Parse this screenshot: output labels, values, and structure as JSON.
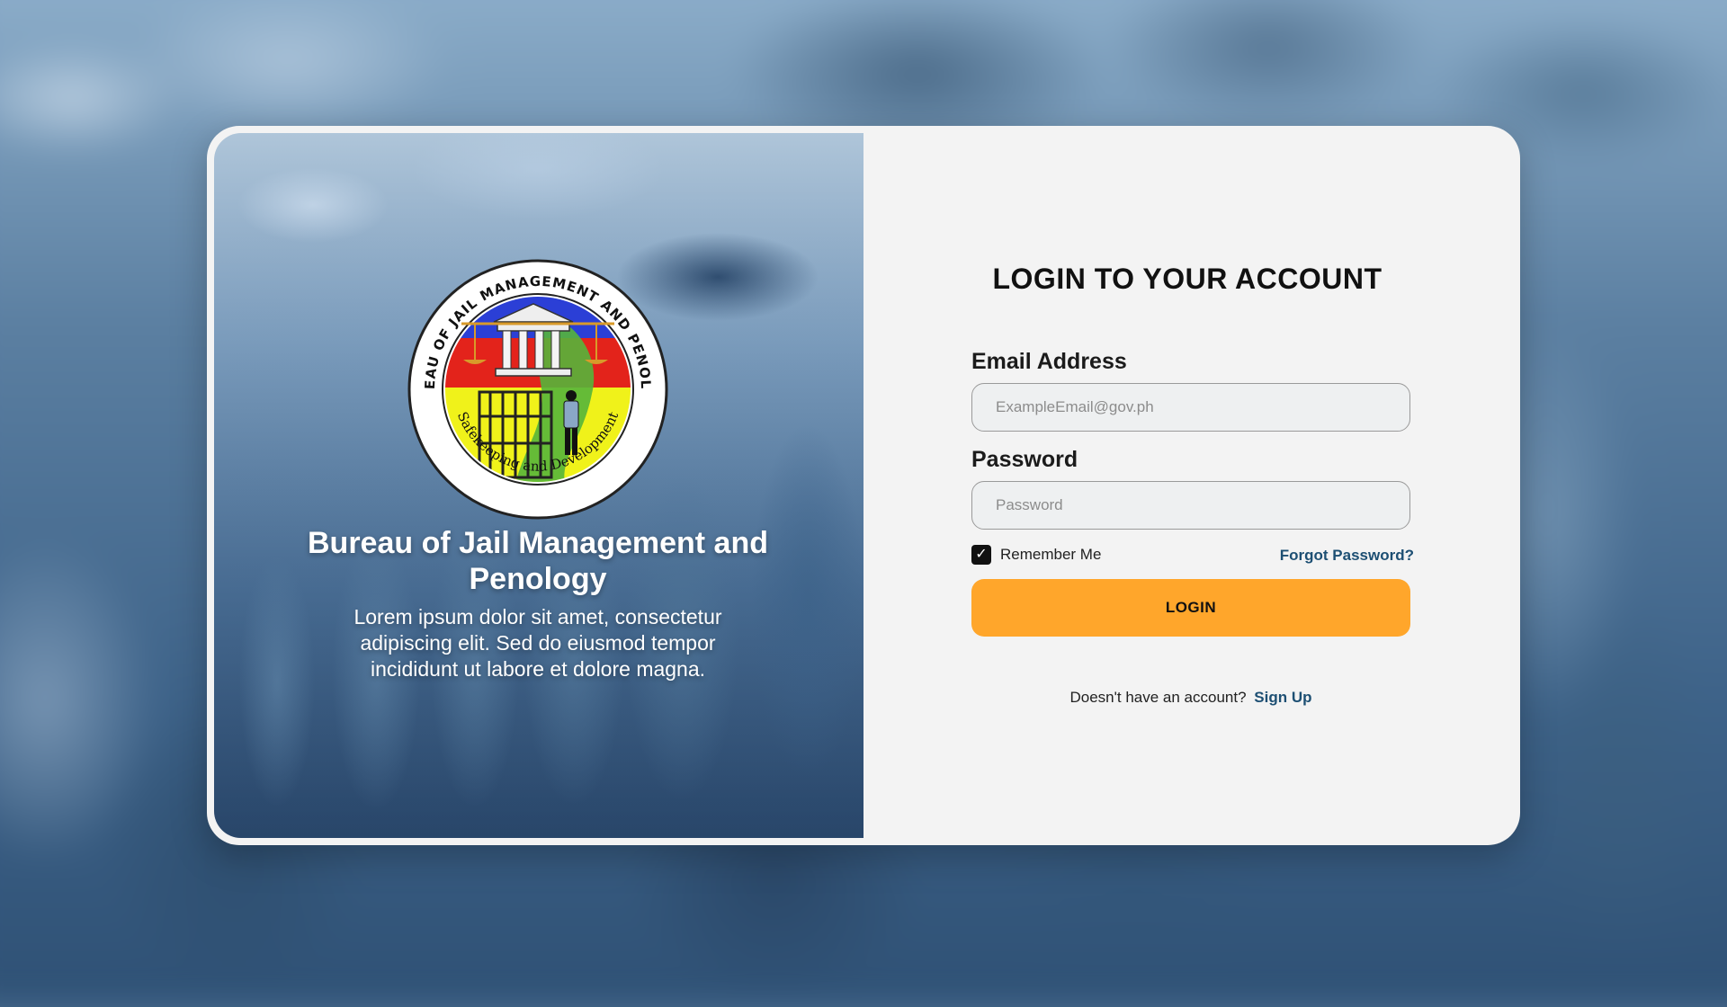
{
  "hero": {
    "org_name": "Bureau of Jail Management and Penology",
    "description": "Lorem ipsum dolor sit amet, consectetur adipiscing elit. Sed do eiusmod tempor incididunt ut labore et dolore magna.",
    "seal": {
      "ring_text_top": "BUREAU OF JAIL MANAGEMENT AND PENOLOGY",
      "ring_text_bottom": "Safekeeping and Development"
    }
  },
  "form": {
    "title": "LOGIN TO YOUR ACCOUNT",
    "email_label": "Email Address",
    "email_placeholder": "ExampleEmail@gov.ph",
    "email_value": "",
    "password_label": "Password",
    "password_placeholder": "Password",
    "password_value": "",
    "remember_label": "Remember Me",
    "remember_checked": true,
    "forgot_label": "Forgot Password?",
    "login_label": "LOGIN",
    "signup_prompt": "Doesn't have an account?",
    "signup_label": "Sign Up"
  },
  "colors": {
    "accent": "#ffa62b",
    "link": "#1d4f73",
    "card_bg": "#f3f3f3"
  },
  "icons": {
    "checkbox": "check-icon"
  }
}
